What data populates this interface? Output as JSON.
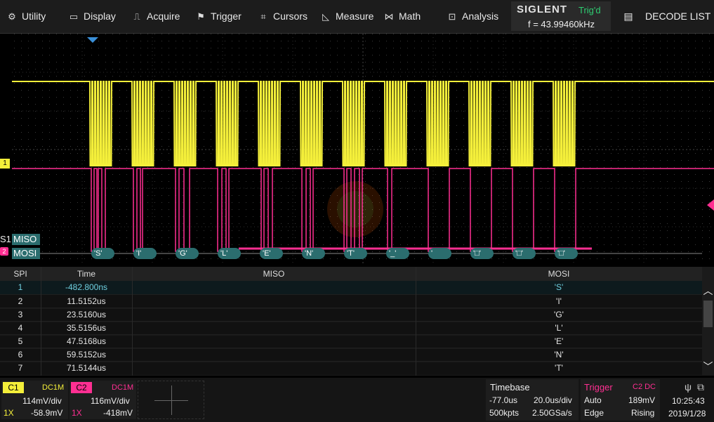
{
  "menu": {
    "utility": {
      "label": "Utility",
      "icon": "gear-icon"
    },
    "display": {
      "label": "Display",
      "icon": "monitor-icon"
    },
    "acquire": {
      "label": "Acquire",
      "icon": "acquire-icon"
    },
    "trigger": {
      "label": "Trigger",
      "icon": "flag-icon"
    },
    "cursors": {
      "label": "Cursors",
      "icon": "cursors-icon"
    },
    "measure": {
      "label": "Measure",
      "icon": "measure-icon"
    },
    "math": {
      "label": "Math",
      "icon": "math-icon"
    },
    "analysis": {
      "label": "Analysis",
      "icon": "analysis-icon"
    }
  },
  "brand": {
    "name": "SIGLENT",
    "status": "Trig'd",
    "frequency": "f = 43.99460kHz"
  },
  "decode_list": {
    "label": "DECODE LIST"
  },
  "traces": {
    "bus_label": "S1",
    "miso_label": "MISO",
    "mosi_label": "MOSI",
    "ch1_marker": "1",
    "ch2_marker": "2",
    "colors": {
      "ch1": "#f4ef3a",
      "ch2": "#ff2f92",
      "bus": "#2b6d6e"
    }
  },
  "bus_decodes": [
    "'S'",
    "'I'",
    "'G'",
    "'L'",
    "'E'",
    "'N'",
    "'T'",
    "'_'",
    "'",
    "'□'",
    "'□'",
    "'□'"
  ],
  "table": {
    "headers": {
      "spi": "SPI",
      "time": "Time",
      "miso": "MISO",
      "mosi": "MOSI"
    },
    "rows": [
      {
        "spi": "1",
        "time": "-482.800ns",
        "miso": "",
        "mosi": "'S'"
      },
      {
        "spi": "2",
        "time": "11.5152us",
        "miso": "",
        "mosi": "'I'"
      },
      {
        "spi": "3",
        "time": "23.5160us",
        "miso": "",
        "mosi": "'G'"
      },
      {
        "spi": "4",
        "time": "35.5156us",
        "miso": "",
        "mosi": "'L'"
      },
      {
        "spi": "5",
        "time": "47.5168us",
        "miso": "",
        "mosi": "'E'"
      },
      {
        "spi": "6",
        "time": "59.5152us",
        "miso": "",
        "mosi": "'N'"
      },
      {
        "spi": "7",
        "time": "71.5144us",
        "miso": "",
        "mosi": "'T'"
      }
    ]
  },
  "status": {
    "c1": {
      "tag": "C1",
      "coupling": "DC1M",
      "scale": "114mV/div",
      "probe": "1X",
      "offset": "-58.9mV"
    },
    "c2": {
      "tag": "C2",
      "coupling": "DC1M",
      "scale": "116mV/div",
      "probe": "1X",
      "offset": "-418mV"
    },
    "timebase": {
      "label": "Timebase",
      "delay": "-77.0us",
      "scale": "20.0us/div",
      "points": "500kpts",
      "rate": "2.50GSa/s"
    },
    "trigger": {
      "label": "Trigger",
      "source": "C2 DC",
      "mode": "Auto",
      "level": "189mV",
      "type": "Edge",
      "slope": "Rising"
    },
    "clock": {
      "time": "10:25:43",
      "date": "2019/1/28"
    }
  }
}
